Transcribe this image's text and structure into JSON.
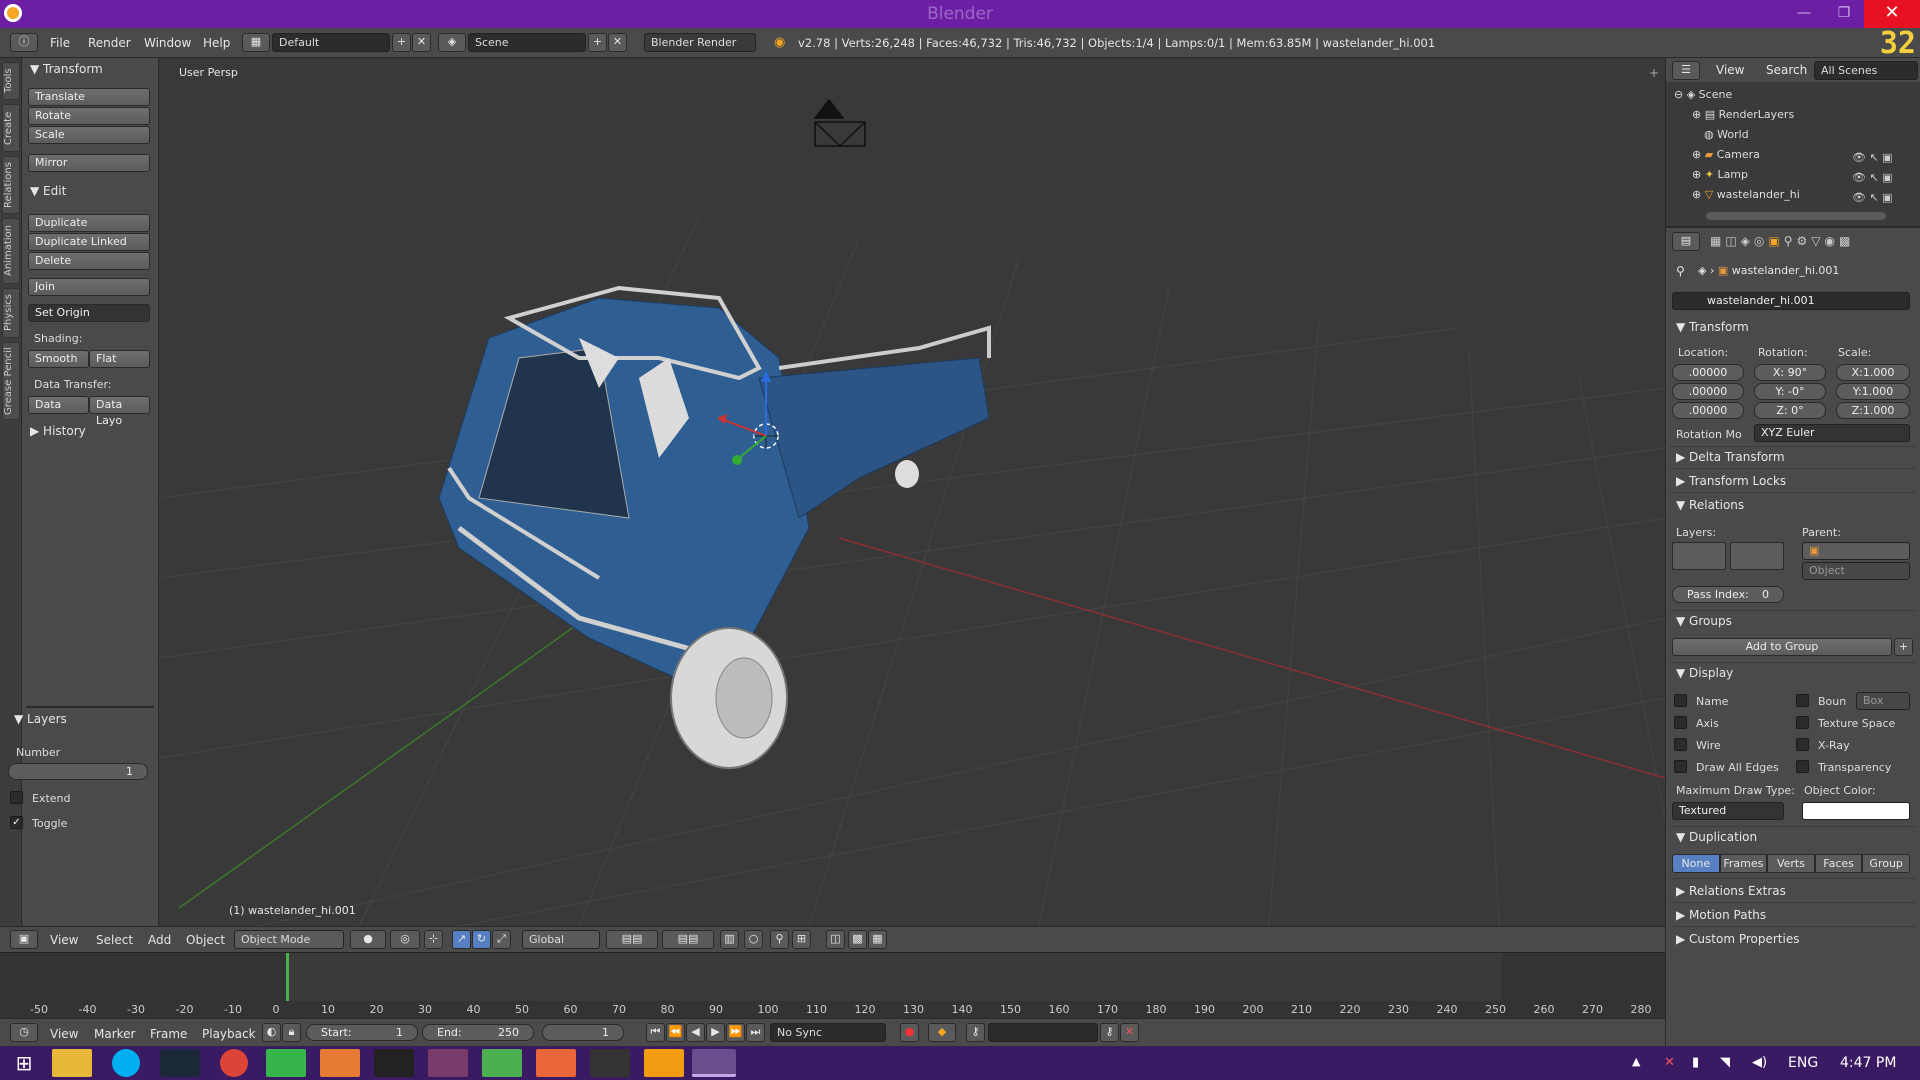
{
  "window": {
    "title": "Blender",
    "close": "✕",
    "minimize": "—",
    "maximize": "❐"
  },
  "info_header": {
    "menus": [
      "File",
      "Render",
      "Window",
      "Help"
    ],
    "layout": "Default",
    "scene": "Scene",
    "engine": "Blender Render",
    "stats": "v2.78 | Verts:26,248 | Faces:46,732 | Tris:46,732 | Objects:1/4 | Lamps:0/1 | Mem:63.85M | wastelander_hi.001",
    "fps": "32"
  },
  "left_tabs": [
    "Tools",
    "Create",
    "Relations",
    "Animation",
    "Physics",
    "Grease Pencil"
  ],
  "tool_panel": {
    "transform_header": "Transform",
    "transform_buttons": [
      "Translate",
      "Rotate",
      "Scale",
      "Mirror"
    ],
    "edit_header": "Edit",
    "edit_buttons": [
      "Duplicate",
      "Duplicate Linked",
      "Delete",
      "Join"
    ],
    "set_origin": "Set Origin",
    "shading_label": "Shading:",
    "smooth": "Smooth",
    "flat": "Flat",
    "data_transfer_label": "Data Transfer:",
    "data": "Data",
    "data_layo": "Data Layo",
    "history_header": "History",
    "layers_header": "Layers",
    "number_label": "Number",
    "number_value": "1",
    "extend": "Extend",
    "toggle": "Toggle"
  },
  "viewport": {
    "label": "User Persp",
    "object_label": "(1) wastelander_hi.001"
  },
  "view3d_header": {
    "menus": [
      "View",
      "Select",
      "Add",
      "Object"
    ],
    "mode": "Object Mode",
    "orientation": "Global"
  },
  "timeline": {
    "ticks": [
      "-50",
      "-40",
      "-30",
      "-20",
      "-10",
      "0",
      "10",
      "20",
      "30",
      "40",
      "50",
      "60",
      "70",
      "80",
      "90",
      "100",
      "110",
      "120",
      "130",
      "140",
      "150",
      "160",
      "170",
      "180",
      "190",
      "200",
      "210",
      "220",
      "230",
      "240",
      "250",
      "260",
      "270",
      "280"
    ],
    "menus": [
      "View",
      "Marker",
      "Frame",
      "Playback"
    ],
    "start": "Start:",
    "start_value": "1",
    "end": "End:",
    "end_value": "250",
    "current": "1",
    "sync": "No Sync"
  },
  "outliner": {
    "menus": [
      "View",
      "Search"
    ],
    "filter": "All Scenes",
    "items": [
      "Scene",
      "RenderLayers",
      "World",
      "Camera",
      "Lamp",
      "wastelander_hi"
    ]
  },
  "properties": {
    "object_path": "wastelander_hi.001",
    "object_name": "wastelander_hi.001",
    "transform_header": "Transform",
    "location_label": "Location:",
    "rotation_label": "Rotation:",
    "scale_label": "Scale:",
    "location": [
      ".00000",
      ".00000",
      ".00000"
    ],
    "rotation": [
      "X:",
      "90°",
      "Y:",
      "-0°",
      "Z:",
      "0°"
    ],
    "scale": [
      "X:1.000",
      "Y:1.000",
      "Z:1.000"
    ],
    "rotation_mode_label": "Rotation Mo",
    "rotation_mode": "XYZ Euler",
    "delta_transform": "Delta Transform",
    "transform_locks": "Transform Locks",
    "relations": "Relations",
    "layers_label": "Layers:",
    "parent_label": "Parent:",
    "parent_type": "Object",
    "pass_index": "Pass Index:",
    "pass_index_value": "0",
    "groups": "Groups",
    "add_to_group": "Add to Group",
    "display": "Display",
    "display_left": [
      "Name",
      "Axis",
      "Wire",
      "Draw All Edges"
    ],
    "display_right": [
      "Boun",
      "Texture Space",
      "X-Ray",
      "Transparency"
    ],
    "bounds_type": "Box",
    "max_draw_type_label": "Maximum Draw Type:",
    "object_color_label": "Object Color:",
    "max_draw_type": "Textured",
    "duplication": "Duplication",
    "dup_tabs": [
      "None",
      "Frames",
      "Verts",
      "Faces",
      "Group"
    ],
    "relations_extras": "Relations Extras",
    "motion_paths": "Motion Paths",
    "custom_properties": "Custom Properties"
  },
  "taskbar": {
    "language": "ENG",
    "time": "4:47 PM"
  }
}
